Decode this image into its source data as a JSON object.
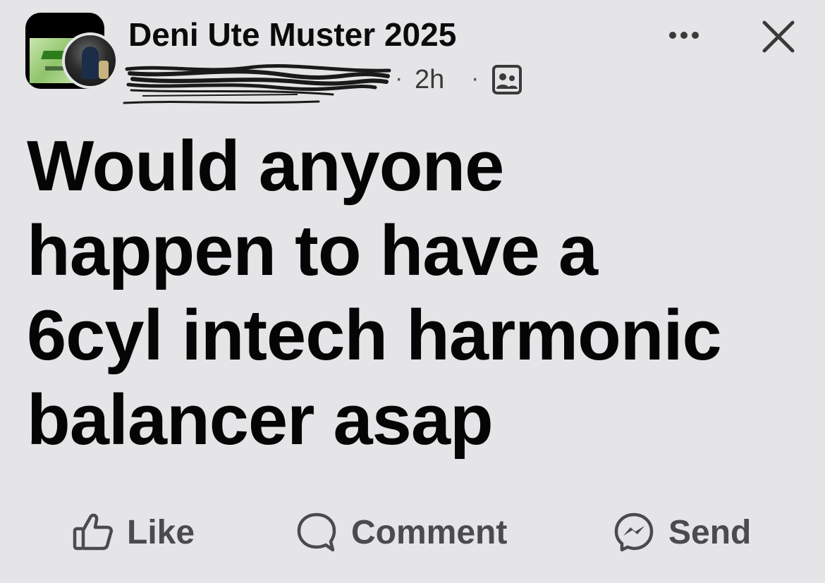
{
  "post": {
    "group_name": "Deni Ute Muster 2025",
    "time_separator_1": "·",
    "time": "2h",
    "time_separator_2": "·",
    "text_lines": [
      "Would anyone",
      "happen to have a",
      "6cyl intech harmonic",
      "balancer asap"
    ]
  },
  "header": {
    "more_label": "•••",
    "more_icon": "more-horizontal-icon",
    "close_icon": "close-icon",
    "audience_icon": "group-members-icon"
  },
  "actions": {
    "like_label": "Like",
    "comment_label": "Comment",
    "send_label": "Send",
    "like_icon": "thumbs-up-icon",
    "comment_icon": "speech-bubble-icon",
    "send_icon": "messenger-icon"
  },
  "colors": {
    "background": "#e5e5e7",
    "text": "#0b0b0b",
    "action_text": "#4a4b4e"
  }
}
